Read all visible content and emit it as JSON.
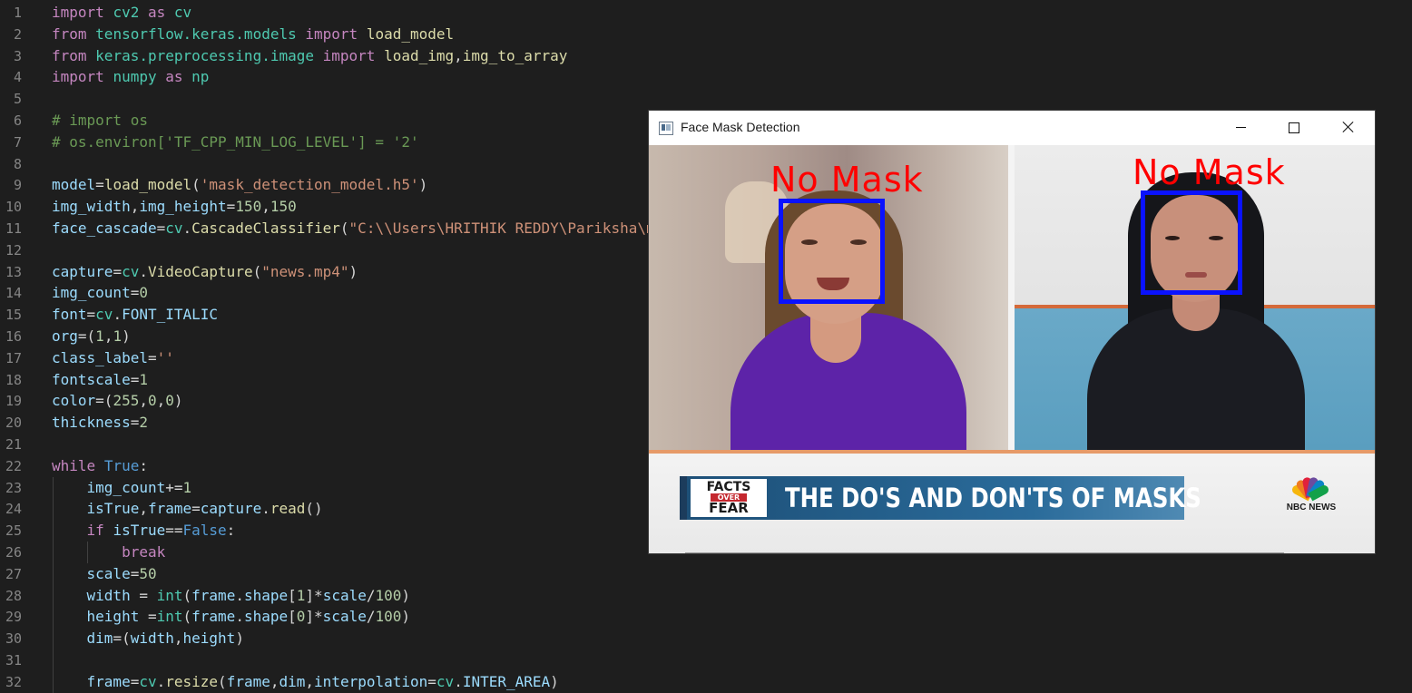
{
  "editor": {
    "lines": [
      {
        "n": "1",
        "tokens": [
          [
            "kw",
            "import"
          ],
          [
            "pl",
            " "
          ],
          [
            "cls",
            "cv2"
          ],
          [
            "pl",
            " "
          ],
          [
            "kw",
            "as"
          ],
          [
            "pl",
            " "
          ],
          [
            "cls",
            "cv"
          ]
        ]
      },
      {
        "n": "2",
        "tokens": [
          [
            "kw",
            "from"
          ],
          [
            "pl",
            " "
          ],
          [
            "cls",
            "tensorflow.keras.models"
          ],
          [
            "pl",
            " "
          ],
          [
            "kw",
            "import"
          ],
          [
            "pl",
            " "
          ],
          [
            "fn",
            "load_model"
          ]
        ]
      },
      {
        "n": "3",
        "tokens": [
          [
            "kw",
            "from"
          ],
          [
            "pl",
            " "
          ],
          [
            "cls",
            "keras.preprocessing.image"
          ],
          [
            "pl",
            " "
          ],
          [
            "kw",
            "import"
          ],
          [
            "pl",
            " "
          ],
          [
            "fn",
            "load_img"
          ],
          [
            "pl",
            ","
          ],
          [
            "fn",
            "img_to_array"
          ]
        ]
      },
      {
        "n": "4",
        "tokens": [
          [
            "kw",
            "import"
          ],
          [
            "pl",
            " "
          ],
          [
            "cls",
            "numpy"
          ],
          [
            "pl",
            " "
          ],
          [
            "kw",
            "as"
          ],
          [
            "pl",
            " "
          ],
          [
            "cls",
            "np"
          ]
        ]
      },
      {
        "n": "5",
        "tokens": []
      },
      {
        "n": "6",
        "tokens": [
          [
            "cmt",
            "# import os"
          ]
        ]
      },
      {
        "n": "7",
        "tokens": [
          [
            "cmt",
            "# os.environ['TF_CPP_MIN_LOG_LEVEL'] = '2'"
          ]
        ]
      },
      {
        "n": "8",
        "tokens": []
      },
      {
        "n": "9",
        "tokens": [
          [
            "var",
            "model"
          ],
          [
            "pl",
            "="
          ],
          [
            "fn",
            "load_model"
          ],
          [
            "pl",
            "("
          ],
          [
            "str",
            "'mask_detection_model.h5'"
          ],
          [
            "pl",
            ")"
          ]
        ]
      },
      {
        "n": "10",
        "tokens": [
          [
            "var",
            "img_width"
          ],
          [
            "pl",
            ","
          ],
          [
            "var",
            "img_height"
          ],
          [
            "pl",
            "="
          ],
          [
            "num",
            "150"
          ],
          [
            "pl",
            ","
          ],
          [
            "num",
            "150"
          ]
        ]
      },
      {
        "n": "11",
        "tokens": [
          [
            "var",
            "face_cascade"
          ],
          [
            "pl",
            "="
          ],
          [
            "cls",
            "cv"
          ],
          [
            "pl",
            "."
          ],
          [
            "fn",
            "CascadeClassifier"
          ],
          [
            "pl",
            "("
          ],
          [
            "str",
            "\"C:\\\\Users\\HRITHIK REDDY\\Pariksha\\m"
          ]
        ]
      },
      {
        "n": "12",
        "tokens": []
      },
      {
        "n": "13",
        "tokens": [
          [
            "var",
            "capture"
          ],
          [
            "pl",
            "="
          ],
          [
            "cls",
            "cv"
          ],
          [
            "pl",
            "."
          ],
          [
            "fn",
            "VideoCapture"
          ],
          [
            "pl",
            "("
          ],
          [
            "str",
            "\"news.mp4\""
          ],
          [
            "pl",
            ")"
          ]
        ]
      },
      {
        "n": "14",
        "tokens": [
          [
            "var",
            "img_count"
          ],
          [
            "pl",
            "="
          ],
          [
            "num",
            "0"
          ]
        ]
      },
      {
        "n": "15",
        "tokens": [
          [
            "var",
            "font"
          ],
          [
            "pl",
            "="
          ],
          [
            "cls",
            "cv"
          ],
          [
            "pl",
            "."
          ],
          [
            "var",
            "FONT_ITALIC"
          ]
        ]
      },
      {
        "n": "16",
        "tokens": [
          [
            "var",
            "org"
          ],
          [
            "pl",
            "=("
          ],
          [
            "num",
            "1"
          ],
          [
            "pl",
            ","
          ],
          [
            "num",
            "1"
          ],
          [
            "pl",
            ")"
          ]
        ]
      },
      {
        "n": "17",
        "tokens": [
          [
            "var",
            "class_label"
          ],
          [
            "pl",
            "="
          ],
          [
            "str",
            "''"
          ]
        ]
      },
      {
        "n": "18",
        "tokens": [
          [
            "var",
            "fontscale"
          ],
          [
            "pl",
            "="
          ],
          [
            "num",
            "1"
          ]
        ]
      },
      {
        "n": "19",
        "tokens": [
          [
            "var",
            "color"
          ],
          [
            "pl",
            "=("
          ],
          [
            "num",
            "255"
          ],
          [
            "pl",
            ","
          ],
          [
            "num",
            "0"
          ],
          [
            "pl",
            ","
          ],
          [
            "num",
            "0"
          ],
          [
            "pl",
            ")"
          ]
        ]
      },
      {
        "n": "20",
        "tokens": [
          [
            "var",
            "thickness"
          ],
          [
            "pl",
            "="
          ],
          [
            "num",
            "2"
          ]
        ]
      },
      {
        "n": "21",
        "tokens": []
      },
      {
        "n": "22",
        "tokens": [
          [
            "kw",
            "while"
          ],
          [
            "pl",
            " "
          ],
          [
            "bl",
            "True"
          ],
          [
            "pl",
            ":"
          ]
        ]
      },
      {
        "n": "23",
        "tokens": [
          [
            "pl",
            "    "
          ],
          [
            "var",
            "img_count"
          ],
          [
            "pl",
            "+="
          ],
          [
            "num",
            "1"
          ]
        ]
      },
      {
        "n": "24",
        "tokens": [
          [
            "pl",
            "    "
          ],
          [
            "var",
            "isTrue"
          ],
          [
            "pl",
            ","
          ],
          [
            "var",
            "frame"
          ],
          [
            "pl",
            "="
          ],
          [
            "var",
            "capture"
          ],
          [
            "pl",
            "."
          ],
          [
            "fn",
            "read"
          ],
          [
            "pl",
            "()"
          ]
        ]
      },
      {
        "n": "25",
        "tokens": [
          [
            "pl",
            "    "
          ],
          [
            "kw",
            "if"
          ],
          [
            "pl",
            " "
          ],
          [
            "var",
            "isTrue"
          ],
          [
            "pl",
            "=="
          ],
          [
            "bl",
            "False"
          ],
          [
            "pl",
            ":"
          ]
        ]
      },
      {
        "n": "26",
        "tokens": [
          [
            "pl",
            "        "
          ],
          [
            "kw",
            "break"
          ]
        ]
      },
      {
        "n": "27",
        "tokens": [
          [
            "pl",
            "    "
          ],
          [
            "var",
            "scale"
          ],
          [
            "pl",
            "="
          ],
          [
            "num",
            "50"
          ]
        ]
      },
      {
        "n": "28",
        "tokens": [
          [
            "pl",
            "    "
          ],
          [
            "var",
            "width"
          ],
          [
            "pl",
            " = "
          ],
          [
            "cls",
            "int"
          ],
          [
            "pl",
            "("
          ],
          [
            "var",
            "frame"
          ],
          [
            "pl",
            "."
          ],
          [
            "var",
            "shape"
          ],
          [
            "pl",
            "["
          ],
          [
            "num",
            "1"
          ],
          [
            "pl",
            "]*"
          ],
          [
            "var",
            "scale"
          ],
          [
            "pl",
            "/"
          ],
          [
            "num",
            "100"
          ],
          [
            "pl",
            ")"
          ]
        ]
      },
      {
        "n": "29",
        "tokens": [
          [
            "pl",
            "    "
          ],
          [
            "var",
            "height"
          ],
          [
            "pl",
            " ="
          ],
          [
            "cls",
            "int"
          ],
          [
            "pl",
            "("
          ],
          [
            "var",
            "frame"
          ],
          [
            "pl",
            "."
          ],
          [
            "var",
            "shape"
          ],
          [
            "pl",
            "["
          ],
          [
            "num",
            "0"
          ],
          [
            "pl",
            "]*"
          ],
          [
            "var",
            "scale"
          ],
          [
            "pl",
            "/"
          ],
          [
            "num",
            "100"
          ],
          [
            "pl",
            ")"
          ]
        ]
      },
      {
        "n": "30",
        "tokens": [
          [
            "pl",
            "    "
          ],
          [
            "var",
            "dim"
          ],
          [
            "pl",
            "=("
          ],
          [
            "var",
            "width"
          ],
          [
            "pl",
            ","
          ],
          [
            "var",
            "height"
          ],
          [
            "pl",
            ")"
          ]
        ]
      },
      {
        "n": "31",
        "tokens": []
      },
      {
        "n": "32",
        "tokens": [
          [
            "pl",
            "    "
          ],
          [
            "var",
            "frame"
          ],
          [
            "pl",
            "="
          ],
          [
            "cls",
            "cv"
          ],
          [
            "pl",
            "."
          ],
          [
            "fn",
            "resize"
          ],
          [
            "pl",
            "("
          ],
          [
            "var",
            "frame"
          ],
          [
            "pl",
            ","
          ],
          [
            "var",
            "dim"
          ],
          [
            "pl",
            ","
          ],
          [
            "var",
            "interpolation"
          ],
          [
            "pl",
            "="
          ],
          [
            "cls",
            "cv"
          ],
          [
            "pl",
            "."
          ],
          [
            "var",
            "INTER_AREA"
          ],
          [
            "pl",
            ")"
          ]
        ]
      }
    ]
  },
  "window": {
    "title": "Face Mask Detection",
    "icons": {
      "app": "app-window-icon",
      "minimize": "minimize-icon",
      "maximize": "maximize-icon",
      "close": "close-icon"
    },
    "detections": [
      {
        "label": "No Mask",
        "box_color": "#0a12ff",
        "label_color": "#ff0000"
      },
      {
        "label": "No Mask",
        "box_color": "#0a12ff",
        "label_color": "#ff0000"
      }
    ],
    "chyron": {
      "badge_top": "FACTS",
      "badge_mid": "OVER",
      "badge_bottom": "FEAR",
      "headline": "THE DO'S AND DON'TS OF MASKS"
    },
    "network_logo": "NBC NEWS",
    "peacock_colors": [
      "#f6b60c",
      "#ef7b21",
      "#e1213b",
      "#6c4c9f",
      "#0b84c7",
      "#12a14a"
    ]
  }
}
